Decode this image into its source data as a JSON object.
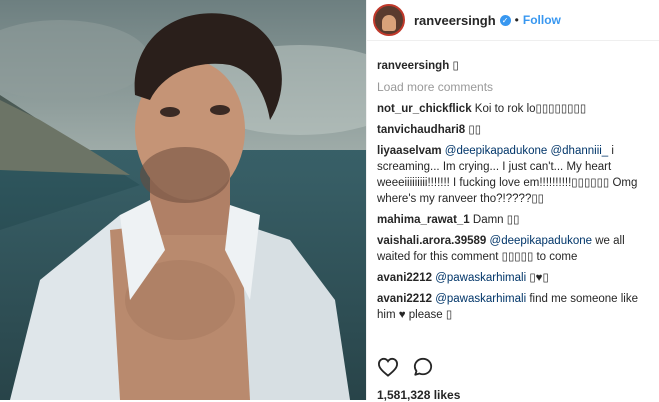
{
  "post": {
    "username": "ranveersingh",
    "follow_label": "Follow",
    "dot": "•",
    "caption_user": "ranveersingh",
    "caption_text": "▯",
    "load_more": "Load more comments",
    "likes": "1,581,328 likes"
  },
  "comments": [
    {
      "user": "not_ur_chickflick",
      "text": "Koi to rok lo▯▯▯▯▯▯▯▯"
    },
    {
      "user": "tanvichaudhari8",
      "text": "▯▯"
    },
    {
      "user": "liyaaselvam",
      "mention1": "@deepikapadukone",
      "mention2": "@dhanniii_",
      "text": " i screaming... Im crying... I just can't... My heart weeeiiiiiiiii!!!!!!! I fucking love em!!!!!!!!!!▯▯▯▯▯▯ Omg where's my ranveer tho?!????▯▯"
    },
    {
      "user": "mahima_rawat_1",
      "text": "Damn ▯▯"
    },
    {
      "user": "vaishali.arora.39589",
      "mention1": "@deepikapadukone",
      "text": " we all waited for this comment ▯▯▯▯▯ to come"
    },
    {
      "user": "avani2212",
      "mention1": "@pawaskarhimali",
      "text": " ▯♥▯"
    },
    {
      "user": "avani2212",
      "mention1": "@pawaskarhimali",
      "text": " find me someone like him ♥ please ▯"
    }
  ],
  "icons": {
    "verified": "verified-badge-icon",
    "like": "heart-icon",
    "comment": "comment-bubble-icon"
  },
  "colors": {
    "accent": "#3897f0",
    "mention": "#003569"
  }
}
